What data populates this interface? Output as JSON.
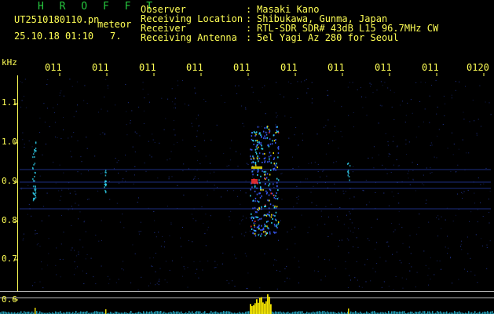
{
  "app": {
    "title": "H R O F F T"
  },
  "file": {
    "name": "UT2510180110.pn",
    "label": "meteor",
    "datetime": "25.10.18 01:10",
    "count": "7."
  },
  "info": {
    "rows": [
      {
        "key": "Observer",
        "value": "Masaki Kano"
      },
      {
        "key": "Receiving Location",
        "value": "Shibukawa, Gunma, Japan"
      },
      {
        "key": "Receiver",
        "value": "RTL-SDR SDR# 43dB L15 96.7MHz CW"
      },
      {
        "key": "Receiving Antenna",
        "value": "5el Yagi Az 280 for Seoul"
      }
    ],
    "separator": ":"
  },
  "axis": {
    "y_unit": "kHz",
    "y_ticks": [
      "1.1",
      "1.0",
      "0.9",
      "0.8",
      "0.7",
      "0.6"
    ],
    "x_ticks": [
      "011",
      "011",
      "011",
      "011",
      "011",
      "011",
      "011",
      "011",
      "011",
      "0120"
    ]
  },
  "colors": {
    "text_yellow": "#ffff55",
    "title_green": "#27c93f",
    "signal_blue": "#3a5cff",
    "signal_cyan": "#33e0ff",
    "signal_yellow": "#ffee00",
    "signal_red": "#ff3030"
  }
}
